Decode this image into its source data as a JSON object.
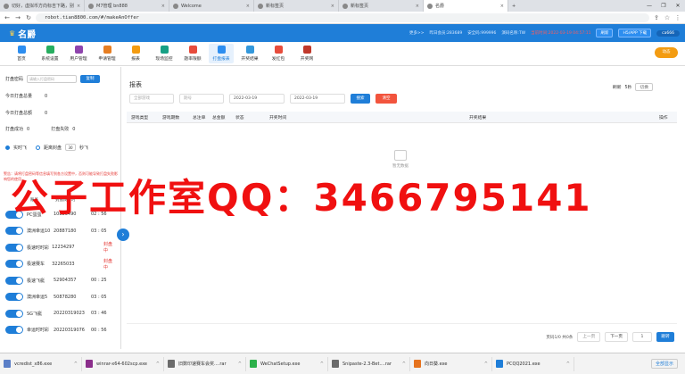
{
  "browser": {
    "tabs": [
      {
        "label": "切好，虚拟币方向标吉下路，别",
        "active": false
      },
      {
        "label": "M7管理 bn888",
        "active": false
      },
      {
        "label": "Welcome",
        "active": false
      },
      {
        "label": "新标签页",
        "active": false
      },
      {
        "label": "新标签页",
        "active": false
      },
      {
        "label": "名爵",
        "active": true
      }
    ],
    "url": "robot.tian8800.com/#/makeAnOffer",
    "win_controls": [
      "—",
      "❐",
      "✕"
    ]
  },
  "header": {
    "logo": "名爵",
    "stats": [
      {
        "label": "更多>>",
        "value": ""
      },
      {
        "label": "昨日会员:",
        "value": "283689"
      },
      {
        "label": "安全码:",
        "value": "999996"
      },
      {
        "label": "演码名称:",
        "value": "TW"
      },
      {
        "label": "当前时间:",
        "value": "2022-03-19 04:57:11",
        "red": true
      }
    ],
    "refresh_label": "刷新",
    "app_label": "H5/APP 下载",
    "user": "ca666",
    "orange_btn": "动态"
  },
  "menu": [
    {
      "label": "首页",
      "color": "#2d8ef0"
    },
    {
      "label": "系统设置",
      "color": "#27ae60"
    },
    {
      "label": "用户管理",
      "color": "#8e44ad"
    },
    {
      "label": "申请管理",
      "color": "#e67e22"
    },
    {
      "label": "报表",
      "color": "#f39c12"
    },
    {
      "label": "现场监控",
      "color": "#16a085"
    },
    {
      "label": "题率限额",
      "color": "#e74c3c"
    },
    {
      "label": "打盘报表",
      "color": "#2d8ef0",
      "active": true
    },
    {
      "label": "开奖结果",
      "color": "#3498db"
    },
    {
      "label": "发红包",
      "color": "#e74c3c"
    },
    {
      "label": "开奖网",
      "color": "#c0392b"
    }
  ],
  "sidebar": {
    "code_label": "打盘密码",
    "code_placeholder": "请输入打盘密码",
    "copy_btn": "复制",
    "today_total_label": "今日打盘总量",
    "today_total": "0",
    "today_amount_label": "今日打盘总额",
    "today_amount": "0",
    "success_label": "打盘成功",
    "success": "0",
    "fail_label": "打盘失败",
    "fail": "0",
    "realtime_label": "实时飞",
    "delay_label": "距离封盘",
    "delay_value": "30",
    "delay_unit": "秒飞",
    "warning": "警告：请将打盘密码等信息填写到各方设置中，否则可能导致打盘失败影响您的使用。",
    "col_account": "账号",
    "col_countdown": "封盘倒计时",
    "rows": [
      {
        "name": "PC蛋蛋",
        "num": "10883490",
        "time": "02 : 56",
        "status": ""
      },
      {
        "name": "澳洲幸运10",
        "num": "20887180",
        "time": "03 : 05",
        "status": ""
      },
      {
        "name": "极速时时彩",
        "num": "12234297",
        "time": "",
        "status": "封盘中"
      },
      {
        "name": "极速赛车",
        "num": "32265033",
        "time": "",
        "status": "封盘中"
      },
      {
        "name": "极速飞艇",
        "num": "52904357",
        "time": "00 : 25",
        "status": ""
      },
      {
        "name": "澳洲幸运5",
        "num": "50878280",
        "time": "03 : 05",
        "status": ""
      },
      {
        "name": "SG飞艇",
        "num": "20220319023",
        "time": "03 : 46",
        "status": ""
      },
      {
        "name": "幸运时时彩",
        "num": "20220319076",
        "time": "00 : 56",
        "status": ""
      }
    ]
  },
  "main": {
    "title": "报表",
    "refresh_label": "刷新",
    "refresh_interval": "5秒",
    "refresh_select": "切换",
    "filter_game": "全部游戏",
    "filter_period": "期号",
    "date_start": "2022-03-19",
    "date_end": "2022-03-19",
    "search_btn": "搜索",
    "clear_btn": "清空",
    "columns": [
      "游戏类型",
      "游戏期数",
      "总注单",
      "总金额",
      "状态",
      "开奖时间",
      "开奖结果",
      "操作"
    ],
    "empty_text": "暂无数据",
    "pager_info": "页码1/0 共0条",
    "prev": "上一页",
    "next": "下一页",
    "page_value": "1",
    "go": "跳转"
  },
  "watermark": "公子工作室QQ：3466795141",
  "downloads": [
    {
      "name": "vcredist_x86.exe",
      "color": "#5b7fc7"
    },
    {
      "name": "winrar-x64-602scp.exe",
      "color": "#8b2e8b"
    },
    {
      "name": "旧数印速赛车会奖....rar",
      "color": "#6b6b6b"
    },
    {
      "name": "WeChatSetup.exe",
      "color": "#2db14b"
    },
    {
      "name": "Snipaste-2.3-Bet....rar",
      "color": "#6b6b6b"
    },
    {
      "name": "向日葵.exe",
      "color": "#e6731e"
    },
    {
      "name": "PCQQ2021.exe",
      "color": "#1f7ed8"
    }
  ],
  "show_all": "全部显示"
}
